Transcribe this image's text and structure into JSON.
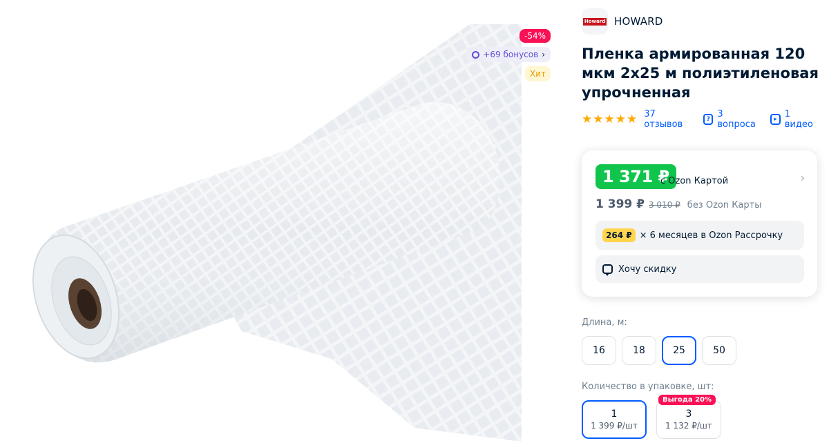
{
  "gallery": {
    "image_alt": "reinforced polyethylene film roll",
    "badges": {
      "discount": "-54%",
      "bonus": "+69 бонусов",
      "hit": "Хит"
    }
  },
  "brand": {
    "logo_text": "Howard",
    "name": "HOWARD"
  },
  "product": {
    "title": "Пленка армированная 120 мкм 2х25 м полиэтиленовая упрочненная"
  },
  "meta": {
    "rating": 5,
    "reviews": "37 отзывов",
    "questions": "3 вопроса",
    "videos": "1 видео"
  },
  "price": {
    "card_price": "1 371 ₽",
    "card_label": "с Ozon Картой",
    "regular_price": "1 399 ₽",
    "old_price": "3 010 ₽",
    "regular_label": "без Ozon Карты",
    "installment_amount": "264 ₽",
    "installment_text": "× 6 месяцев в Ozon Рассрочку",
    "want_discount": "Хочу скидку"
  },
  "length": {
    "label": "Длина, м:",
    "options": [
      "16",
      "18",
      "25",
      "50"
    ],
    "selected": "25"
  },
  "quantity": {
    "label": "Количество в упаковке, шт:",
    "options": [
      {
        "count": "1",
        "price": "1 399 ₽/шт",
        "promo": ""
      },
      {
        "count": "3",
        "price": "1 132 ₽/шт",
        "promo": "Выгода 20%"
      }
    ]
  },
  "colors": {
    "accent": "#005bff",
    "price_green": "#10c44c",
    "discount_red": "#f91155",
    "star": "#ffa800"
  }
}
